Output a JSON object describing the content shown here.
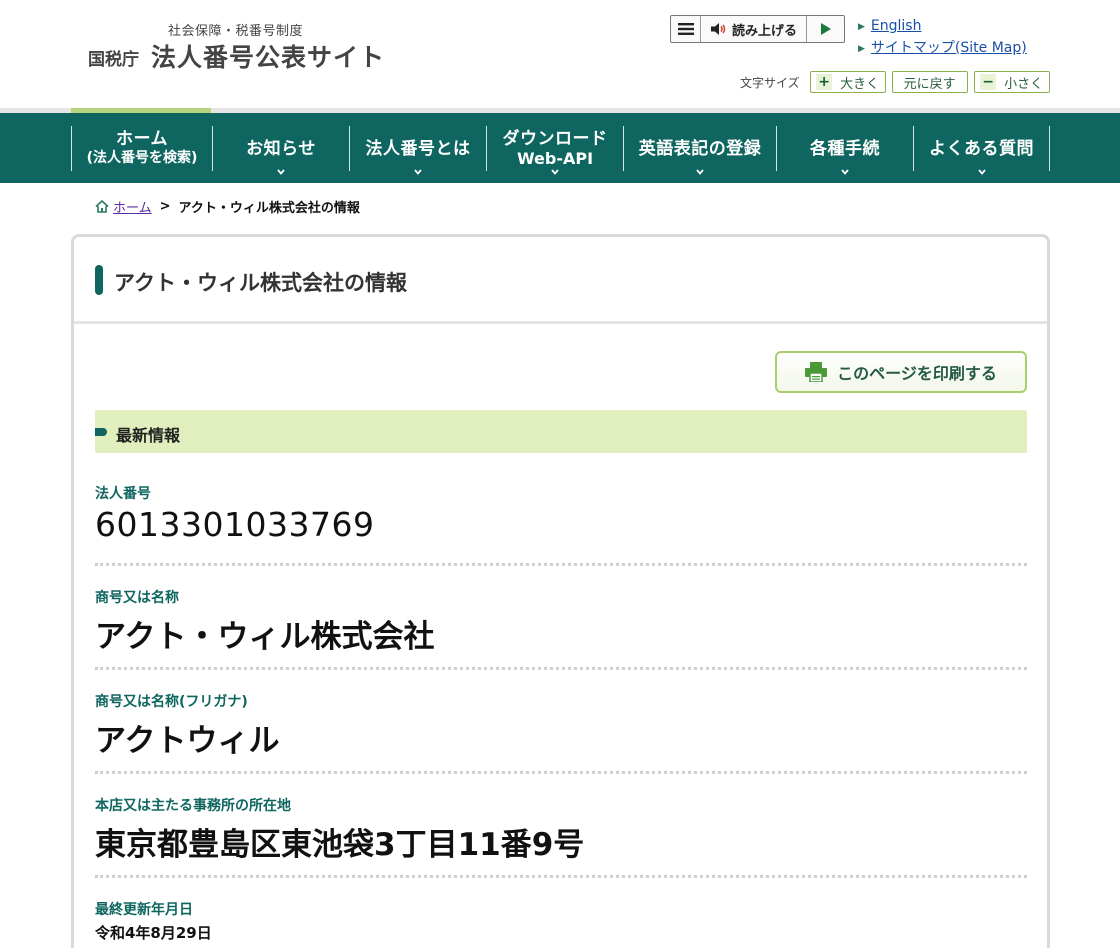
{
  "header": {
    "subtitle": "社会保障・税番号制度",
    "agency": "国税庁",
    "site_name": "法人番号公表サイト",
    "read_aloud_label": "読み上げる",
    "links": [
      {
        "label": "English"
      },
      {
        "label": "サイトマップ(Site Map)"
      }
    ],
    "font_size": {
      "label": "文字サイズ",
      "larger": "大きく",
      "reset": "元に戻す",
      "smaller": "小さく"
    }
  },
  "nav": {
    "items": [
      {
        "line1": "ホーム",
        "line2": "(法人番号を検索)"
      },
      {
        "line1": "お知らせ"
      },
      {
        "line1": "法人番号とは"
      },
      {
        "line1": "ダウンロード",
        "line2": "Web-API"
      },
      {
        "line1": "英語表記の登録"
      },
      {
        "line1": "各種手続"
      },
      {
        "line1": "よくある質問"
      }
    ]
  },
  "breadcrumb": {
    "home": "ホーム",
    "separator": ">",
    "current": "アクト・ウィル株式会社の情報"
  },
  "main": {
    "title": "アクト・ウィル株式会社の情報",
    "print_label": "このページを印刷する",
    "section_title": "最新情報",
    "fields": [
      {
        "label": "法人番号",
        "value": "6013301033769"
      },
      {
        "label": "商号又は名称",
        "value": "アクト・ウィル株式会社"
      },
      {
        "label": "商号又は名称(フリガナ)",
        "value": "アクトウィル"
      },
      {
        "label": "本店又は主たる事務所の所在地",
        "value": "東京都豊島区東池袋3丁目11番9号"
      },
      {
        "label": "最終更新年月日",
        "value": "令和4年8月29日"
      }
    ]
  },
  "colors": {
    "brand_green": "#0f6660",
    "accent_lime": "#b5d47c",
    "section_band": "#e0efbd",
    "link_blue": "#1a4fa8"
  }
}
